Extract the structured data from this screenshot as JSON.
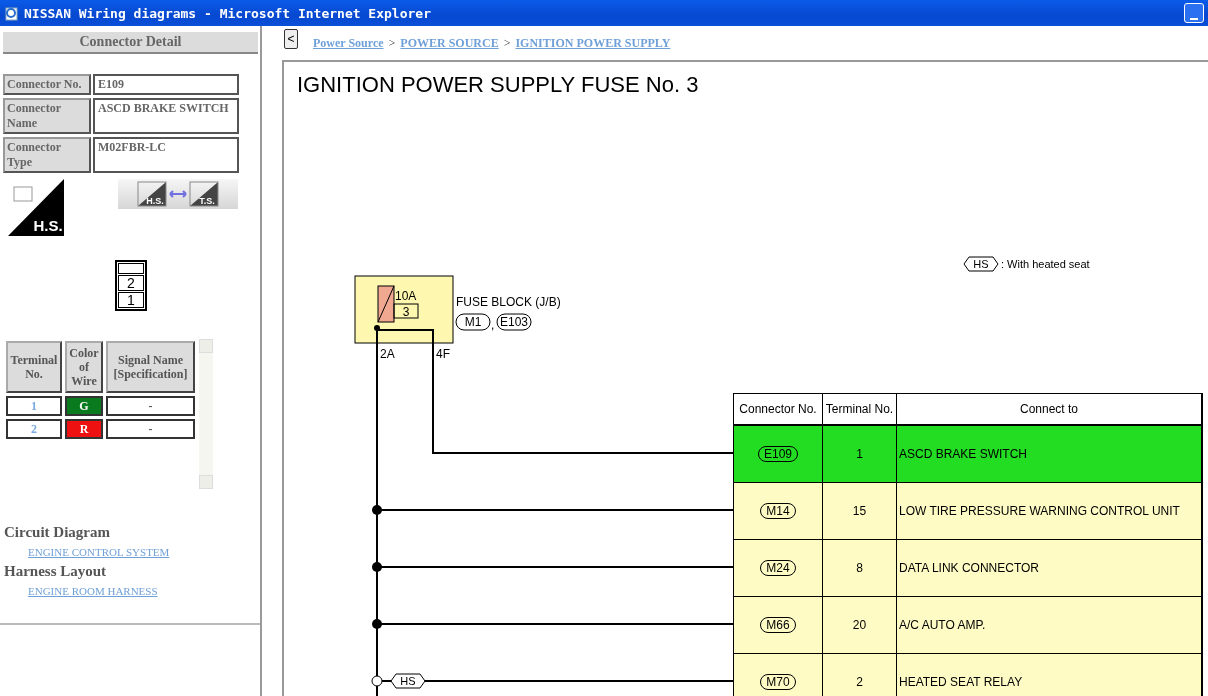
{
  "window": {
    "title": "NISSAN Wiring diagrams - Microsoft Internet Explorer"
  },
  "left_panel": {
    "heading": "Connector Detail",
    "fields": [
      {
        "label": "Connector No.",
        "value": "E109"
      },
      {
        "label": "Connector Name",
        "value": "ASCD BRAKE SWITCH"
      },
      {
        "label": "Connector Type",
        "value": "M02FBR-LC"
      }
    ],
    "view_icon": {
      "label": "H.S."
    },
    "view_toggle": {
      "from": "H.S.",
      "to": "T.S."
    },
    "connector_face": {
      "terminals": [
        "2",
        "1"
      ]
    },
    "terminals_table": {
      "columns": [
        "Terminal No.",
        "Color of Wire",
        "Signal Name [Specification]"
      ],
      "rows": [
        {
          "terminal": "1",
          "wire": "G",
          "color": "#0a7a1e",
          "signal": "-"
        },
        {
          "terminal": "2",
          "wire": "R",
          "color": "#ee1111",
          "signal": "-"
        }
      ]
    },
    "sections": [
      {
        "heading": "Circuit Diagram",
        "link": "ENGINE CONTROL SYSTEM"
      },
      {
        "heading": "Harness Layout",
        "link": "ENGINE ROOM HARNESS"
      }
    ]
  },
  "breadcrumb": {
    "back": "<",
    "separator": ">",
    "items": [
      "Power Source",
      "POWER SOURCE",
      "IGNITION POWER SUPPLY"
    ]
  },
  "diagram": {
    "title": "IGNITION POWER SUPPLY FUSE No. 3",
    "legend": {
      "symbol": "HS",
      "text": ": With heated seat"
    },
    "fuse": {
      "rating": "10A",
      "number": "3",
      "name": "FUSE BLOCK (J/B)",
      "connectors": [
        "M1",
        "E103"
      ],
      "separator": ",",
      "pins": [
        "2A",
        "4F"
      ]
    },
    "connections": {
      "columns": [
        "Connector No.",
        "Terminal No.",
        "Connect to"
      ],
      "rows": [
        {
          "connector": "E109",
          "terminal": "1",
          "connect_to": "ASCD BRAKE SWITCH",
          "selected": true
        },
        {
          "connector": "M14",
          "terminal": "15",
          "connect_to": "LOW TIRE PRESSURE WARNING CONTROL UNIT",
          "selected": false
        },
        {
          "connector": "M24",
          "terminal": "8",
          "connect_to": "DATA LINK CONNECTOR",
          "selected": false
        },
        {
          "connector": "M66",
          "terminal": "20",
          "connect_to": "A/C AUTO AMP.",
          "selected": false
        },
        {
          "connector": "M70",
          "terminal": "2",
          "connect_to": "HEATED SEAT RELAY",
          "selected": false,
          "wire_tag": "HS"
        }
      ]
    }
  }
}
